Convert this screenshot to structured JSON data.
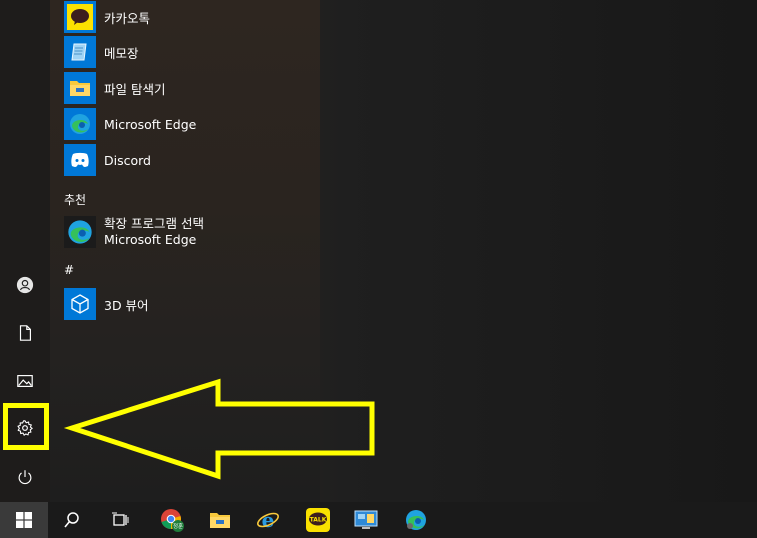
{
  "apps": [
    {
      "label": "카카오톡",
      "icon": "kakaotalk-icon"
    },
    {
      "label": "메모장",
      "icon": "notepad-icon"
    },
    {
      "label": "파일 탐색기",
      "icon": "file-explorer-icon"
    },
    {
      "label": "Microsoft Edge",
      "icon": "edge-icon"
    },
    {
      "label": "Discord",
      "icon": "discord-icon"
    }
  ],
  "recommended": {
    "heading": "추천",
    "item": {
      "title": "확장 프로그램 선택",
      "subtitle": "Microsoft Edge",
      "icon": "edge-icon"
    }
  },
  "hash_section": {
    "heading": "#",
    "item": {
      "label": "3D 뷰어",
      "icon": "3d-viewer-icon"
    }
  },
  "left_rail": [
    "user-icon",
    "document-icon",
    "pictures-icon",
    "settings-icon",
    "power-icon"
  ],
  "taskbar": {
    "chrome_badge": "정훈",
    "kakao_badge": "TALK",
    "icons": [
      "windows-start-icon",
      "search-icon",
      "task-view-icon",
      "chrome-icon",
      "file-explorer-icon",
      "internet-explorer-icon",
      "kakaotalk-icon",
      "control-panel-icon",
      "edge-icon"
    ]
  },
  "colors": {
    "accent_tile": "#0078d7",
    "highlight": "#ffff00"
  }
}
